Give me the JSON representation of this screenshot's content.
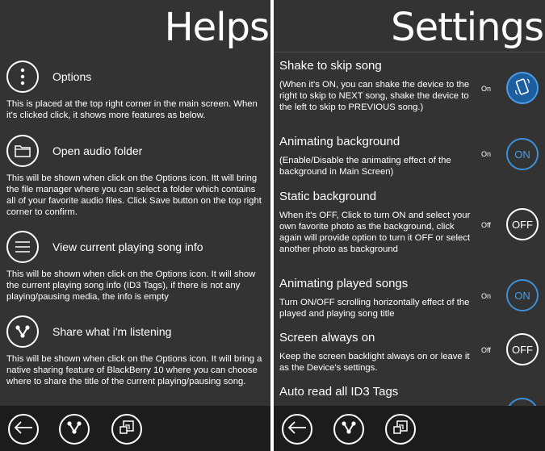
{
  "help": {
    "title": "Helps",
    "items": [
      {
        "label": "Options",
        "icon": "vertical-dots-icon",
        "desc": "This is placed at the top right corner in the main screen. When it's clicked click, it shows more features as below."
      },
      {
        "label": "Open audio folder",
        "icon": "folder-icon",
        "desc": "This will be shown when click on the Options icon. Itt will bring the file manager where you can select a folder which contains all of your favorite audio files. Click Save button on the top right corner to confirm."
      },
      {
        "label": "View current playing song info",
        "icon": "menu-lines-icon",
        "desc": "This will be shown when click on the Options icon. It will show the current playing song info (ID3 Tags), if there is not any playing/pausing media, the info is empty"
      },
      {
        "label": "Share what i'm listening",
        "icon": "share-icon",
        "desc": "This will be shown when click on the Options icon. It will bring a native sharing feature of BlackBerry 10 where you can choose where to share the title of the current playing/pausing song."
      }
    ]
  },
  "settings": {
    "title": "Settings",
    "rows": [
      {
        "title": "Shake to skip song",
        "desc": "(When it's ON, you can shake the device to the right to skip to NEXT song, shake the device to the left to skip to PREVIOUS song.)",
        "state": "On",
        "toggle": "",
        "toggle_icon": "shake-phone-icon"
      },
      {
        "title": "Animating background",
        "desc": "(Enable/Disable the animating effect of the background in Main Screen)",
        "state": "On",
        "toggle": "ON"
      },
      {
        "title": "Static background",
        "desc": "When it's OFF, Click to turn ON and select your own favorite photo as the background, click again will provide option to turn it OFF or select another photo as background",
        "state": "Off",
        "toggle": "OFF"
      },
      {
        "title": "Animating played songs",
        "desc": "Turn ON/OFF scrolling horizontally effect of the played and playing song title",
        "state": "On",
        "toggle": "ON"
      },
      {
        "title": "Screen always on",
        "desc": "Keep the screen backlight always on or leave it as the Device's settings.",
        "state": "Off",
        "toggle": "OFF"
      },
      {
        "title": "Auto read all ID3 Tags",
        "desc": "",
        "state": "",
        "toggle": ""
      }
    ]
  },
  "bottom_bar": {
    "buttons": [
      "back-arrow-icon",
      "share-icon",
      "switch-app-icon"
    ]
  },
  "colors": {
    "panel_bg": "#333333",
    "bar_bg": "#1c1c1c",
    "accent": "#3d8fd8"
  }
}
